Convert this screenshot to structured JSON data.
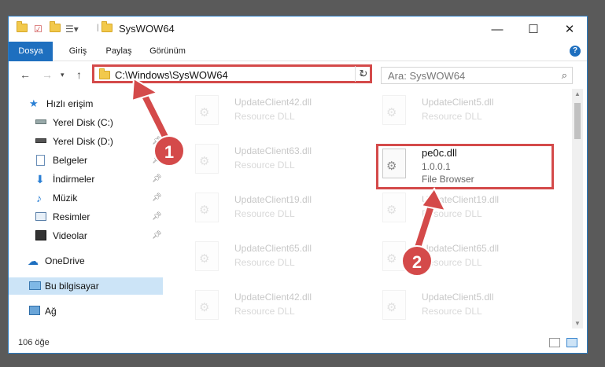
{
  "window": {
    "title": "SysWOW64",
    "controls": {
      "minimize": "—",
      "maximize": "☐",
      "close": "✕"
    }
  },
  "ribbon": {
    "tabs": [
      "Dosya",
      "Giriş",
      "Paylaş",
      "Görünüm"
    ],
    "help": "?"
  },
  "address": {
    "path": "C:\\Windows\\SysWOW64",
    "search_placeholder": "Ara: SysWOW64"
  },
  "sidebar": {
    "items": [
      {
        "label": "Hızlı erişim",
        "icon": "star-icon",
        "pinned": false
      },
      {
        "label": "Yerel Disk (C:)",
        "icon": "drive-icon",
        "pinned": false
      },
      {
        "label": "Yerel Disk (D:)",
        "icon": "drive-icon",
        "pinned": true
      },
      {
        "label": "Belgeler",
        "icon": "documents-icon",
        "pinned": true
      },
      {
        "label": "İndirmeler",
        "icon": "download-icon",
        "pinned": true
      },
      {
        "label": "Müzik",
        "icon": "music-icon",
        "pinned": true
      },
      {
        "label": "Resimler",
        "icon": "pictures-icon",
        "pinned": true
      },
      {
        "label": "Videolar",
        "icon": "video-icon",
        "pinned": true
      },
      {
        "label": "OneDrive",
        "icon": "cloud-icon",
        "pinned": false
      },
      {
        "label": "Bu bilgisayar",
        "icon": "computer-icon",
        "pinned": false,
        "selected": true
      },
      {
        "label": "Ağ",
        "icon": "network-icon",
        "pinned": false
      }
    ]
  },
  "files": {
    "left": [
      {
        "name": "UpdateClient42.dll",
        "desc": "Resource DLL"
      },
      {
        "name": "UpdateClient63.dll",
        "desc": "Resource DLL"
      },
      {
        "name": "UpdateClient19.dll",
        "desc": "Resource DLL"
      },
      {
        "name": "UpdateClient65.dll",
        "desc": "Resource DLL"
      },
      {
        "name": "UpdateClient42.dll",
        "desc": "Resource DLL"
      }
    ],
    "right": [
      {
        "name": "UpdateClient5.dll",
        "desc": "Resource DLL"
      },
      {
        "name": "UpdateClient19.dll",
        "desc": "Resource DLL"
      },
      {
        "name": "UpdateClient65.dll",
        "desc": "Resource DLL"
      },
      {
        "name": "UpdateClient5.dll",
        "desc": "Resource DLL"
      }
    ],
    "highlighted": {
      "name": "pe0c.dll",
      "version": "1.0.0.1",
      "desc": "File Browser"
    }
  },
  "status": {
    "count": "106 öğe"
  },
  "callouts": {
    "one": "1",
    "two": "2"
  },
  "colors": {
    "accent": "#1e6fbf",
    "highlight": "#d44a4a",
    "selected": "#cce4f7"
  }
}
